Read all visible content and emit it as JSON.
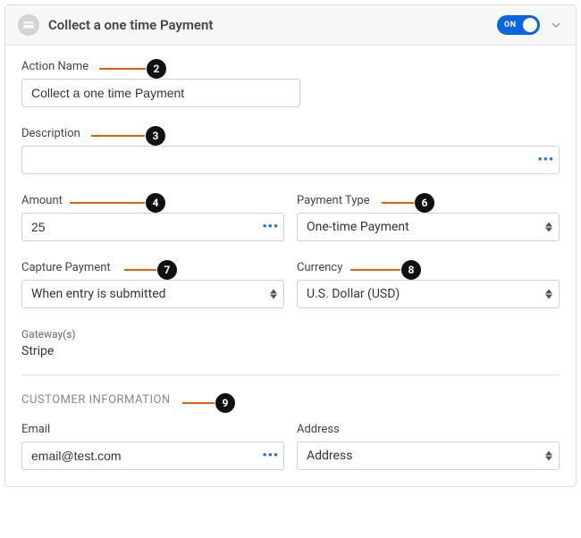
{
  "header": {
    "title": "Collect a one time Payment",
    "toggle_state": "ON"
  },
  "fields": {
    "action_name": {
      "label": "Action Name",
      "value": "Collect a one time Payment"
    },
    "description": {
      "label": "Description",
      "value": ""
    },
    "amount": {
      "label": "Amount",
      "value": "25"
    },
    "payment_type": {
      "label": "Payment Type",
      "value": "One-time Payment"
    },
    "capture_payment": {
      "label": "Capture Payment",
      "value": "When entry is submitted"
    },
    "currency": {
      "label": "Currency",
      "value": "U.S. Dollar (USD)"
    },
    "gateways": {
      "label": "Gateway(s)",
      "value": "Stripe"
    },
    "customer_section": "CUSTOMER INFORMATION",
    "email": {
      "label": "Email",
      "value": "email@test.com"
    },
    "address": {
      "label": "Address",
      "value": "Address"
    }
  },
  "callouts": {
    "n2": "2",
    "n3": "3",
    "n4": "4",
    "n6": "6",
    "n7": "7",
    "n8": "8",
    "n9": "9"
  }
}
